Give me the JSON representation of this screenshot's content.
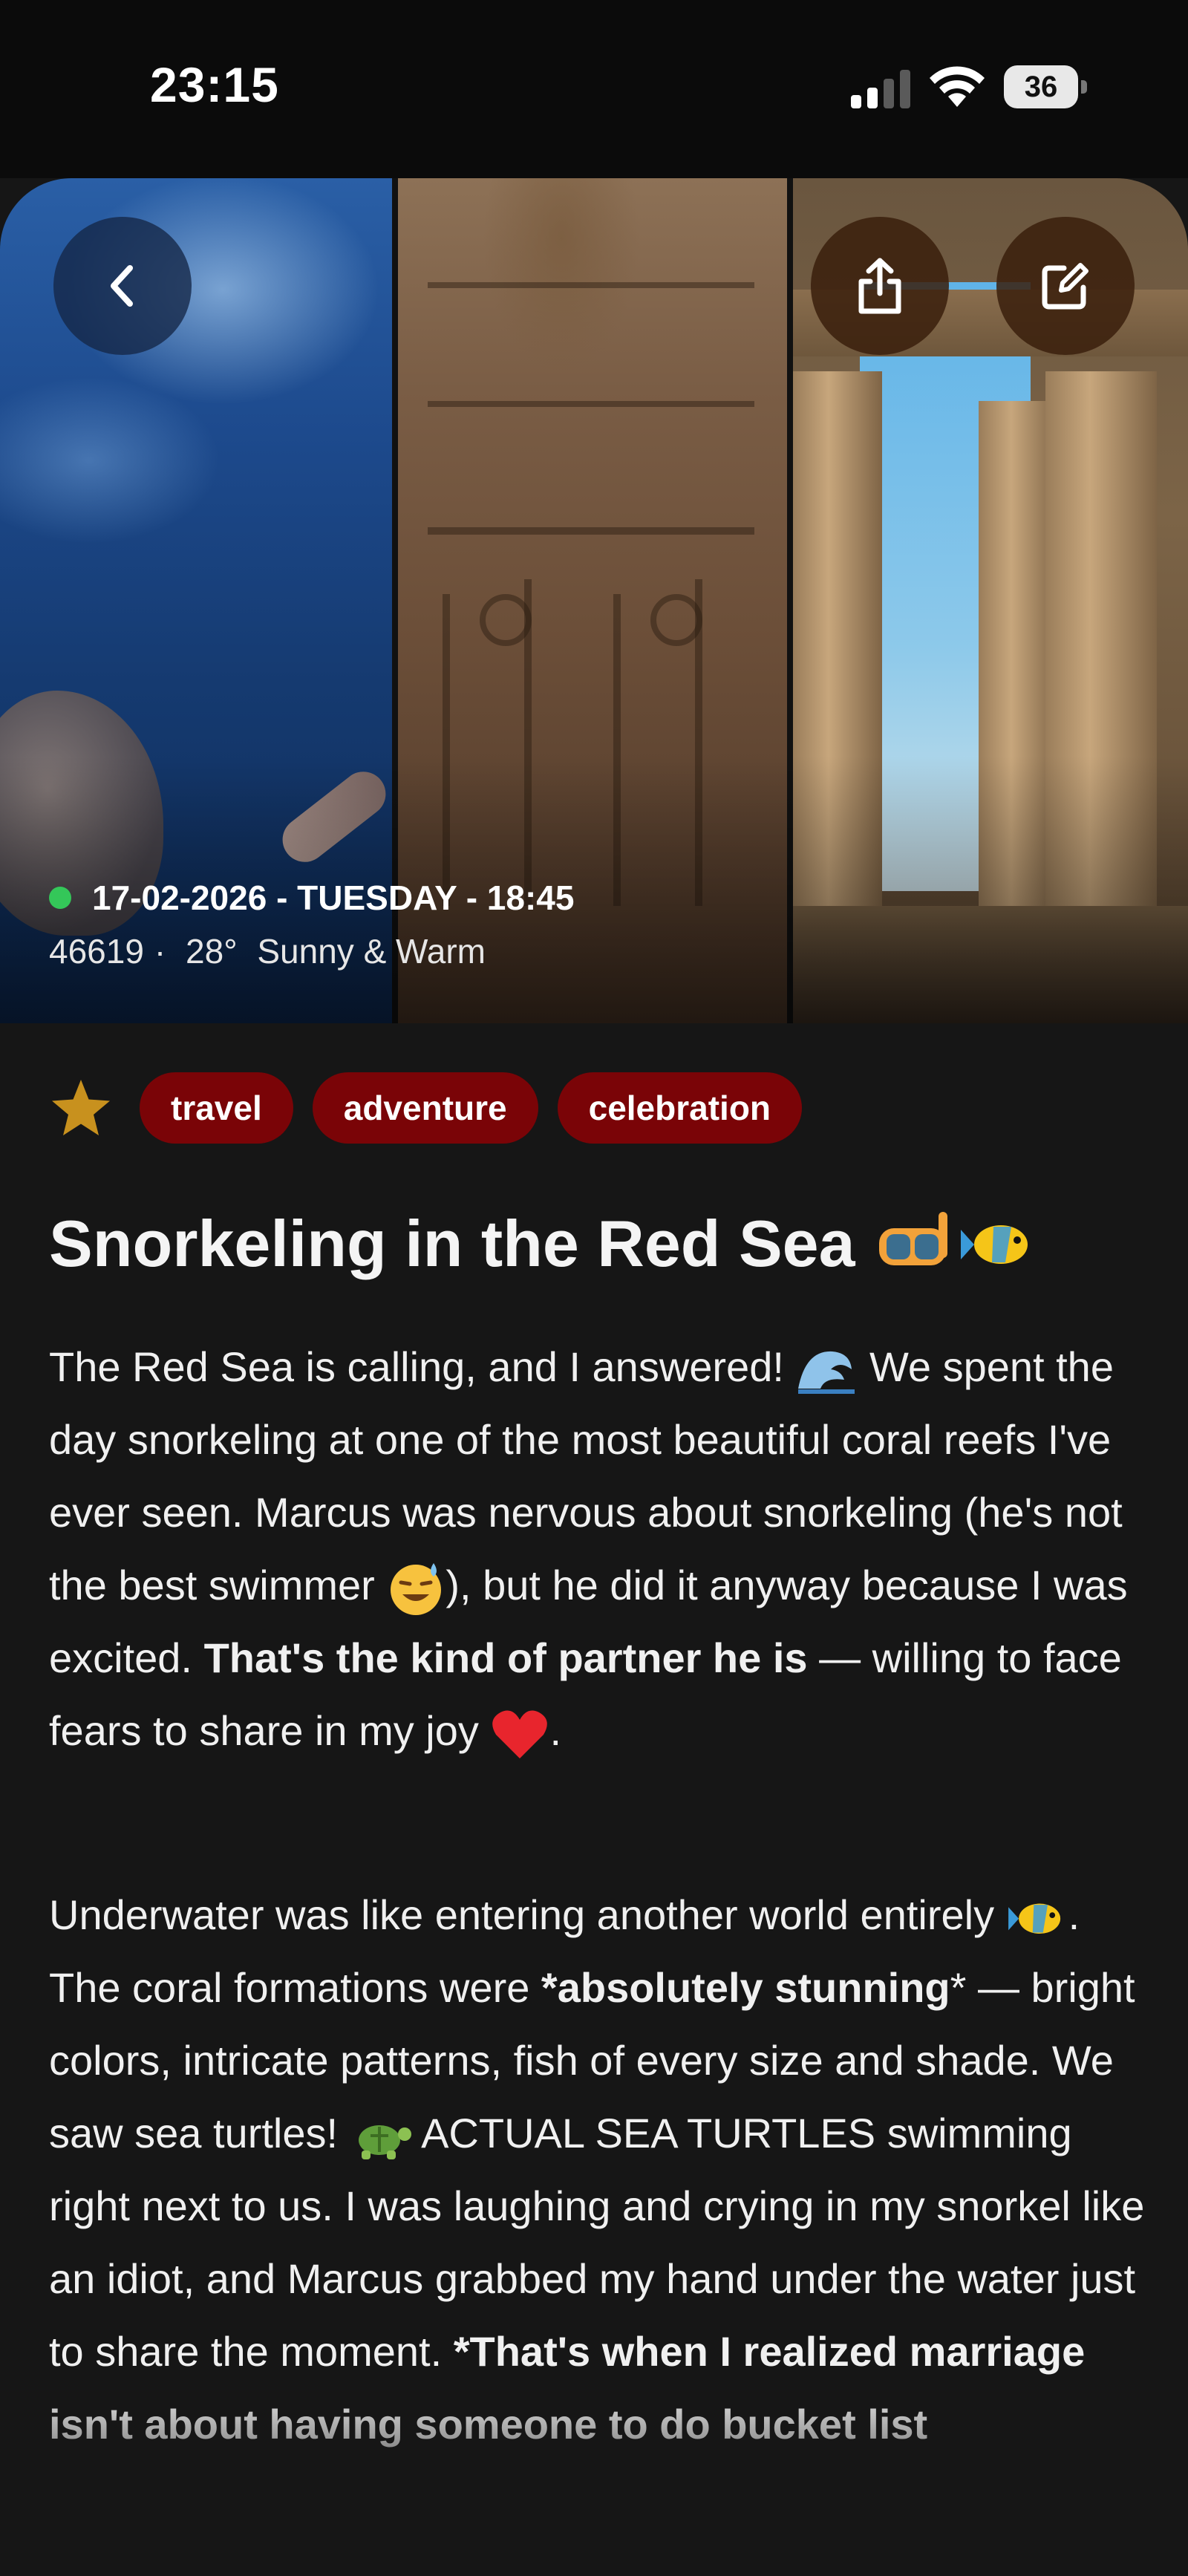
{
  "status_bar": {
    "time": "23:15",
    "battery": "36",
    "icons": [
      "signal-icon",
      "wifi-icon",
      "battery-icon"
    ]
  },
  "hero": {
    "photos": [
      "underwater-snorkel-photo",
      "hieroglyph-carving-photo",
      "temple-columns-photo"
    ],
    "buttons": [
      "back-button",
      "share-button",
      "edit-button"
    ],
    "date_line": "17-02-2026 - TUESDAY - 18:45",
    "stats": {
      "id": "46619",
      "separator": "·",
      "temperature": "28°",
      "weather": "Sunny & Warm"
    },
    "status_dot_color": "#34c759"
  },
  "entry": {
    "starred": true,
    "star_color": "#c8911e",
    "tag_color": "#7a0407",
    "tags": [
      "travel",
      "adventure",
      "celebration"
    ],
    "title": "Snorkeling in the Red Sea",
    "title_emojis": [
      "diving-mask-emoji",
      "tropical-fish-emoji"
    ],
    "paragraph1": {
      "text1": "The Red Sea is calling, and I answered! ",
      "text2": " We spent the day snorkeling at one of the most beautiful coral reefs I've ever seen. Marcus was nervous about snorkeling (he's not the best swimmer ",
      "text3": "), but he did it anyway because I was excited. ",
      "bold1": "That's the kind of partner he is",
      "text4": " — willing to face fears to share in my joy ",
      "text5": "."
    },
    "paragraph2": {
      "text1": "Underwater was like entering another world entirely ",
      "text2": ". The coral formations were ",
      "bold1": "*absolutely stunning",
      "text3": "* — bright colors, intricate patterns, fish of every size and shade. We saw sea turtles! ",
      "text4": " ACTUAL SEA TURTLES swimming right next to us. I was laughing and crying in my snorkel like an idiot, and Marcus grabbed my hand under the water just to share the moment. ",
      "bold2": "*That's when I realized marriage isn't about having someone to do bucket list"
    }
  }
}
